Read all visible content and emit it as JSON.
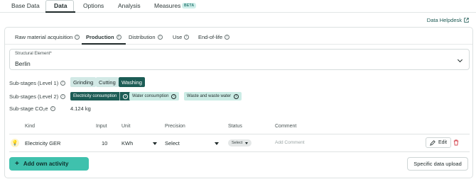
{
  "nav": {
    "tabs": [
      {
        "label": "Base Data"
      },
      {
        "label": "Data"
      },
      {
        "label": "Options"
      },
      {
        "label": "Analysis"
      },
      {
        "label": "Measures"
      }
    ],
    "beta_badge": "BETA",
    "active_tab": "Data"
  },
  "helpdesk": {
    "label": "Data Helpdesk",
    "icon": "external-link-icon"
  },
  "stages": {
    "tabs": [
      {
        "label": "Raw material acquisition"
      },
      {
        "label": "Production"
      },
      {
        "label": "Distribution"
      },
      {
        "label": "Use"
      },
      {
        "label": "End-of-life"
      }
    ],
    "active": "Production"
  },
  "structural_element": {
    "label": "Structural Element*",
    "value": "Berlin"
  },
  "substages_l1": {
    "label": "Sub-stages (Level 1)",
    "items": [
      {
        "label": "Grinding"
      },
      {
        "label": "Cutting"
      },
      {
        "label": "Washing"
      }
    ],
    "selected": "Washing"
  },
  "substages_l2": {
    "label": "Sub-stages (Level 2)",
    "items": [
      {
        "label": "Electricity consumption"
      },
      {
        "label": "Water consumption"
      },
      {
        "label": "Waste and waste water"
      }
    ],
    "selected": "Electricity consumption"
  },
  "substage_co2": {
    "label": "Sub-stage CO₂e",
    "value": "4.124 kg"
  },
  "table": {
    "headers": {
      "kind": "Kind",
      "input": "Input",
      "unit": "Unit",
      "precision": "Precision",
      "status": "Status",
      "comment": "Comment"
    },
    "rows": [
      {
        "icon": "lightbulb-icon",
        "kind": "Electricity GER",
        "input": "10",
        "unit": "KWh",
        "precision": "Select",
        "status": "Select",
        "comment_placeholder": "Add Comment",
        "edit_label": "Edit"
      }
    ]
  },
  "actions": {
    "add_activity": "Add own activity",
    "upload": "Specific data upload"
  },
  "colors": {
    "accent": "#3fc1ad",
    "selected_chip": "#1c5c55",
    "chip": "#d2e9e6",
    "danger": "#d0353f"
  }
}
